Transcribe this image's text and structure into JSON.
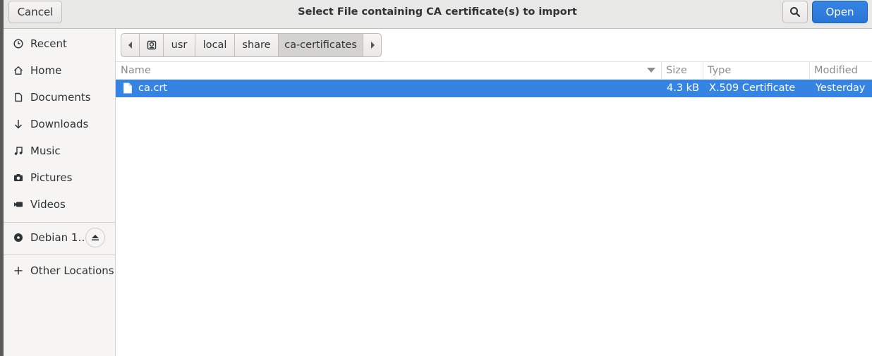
{
  "header": {
    "cancel_label": "Cancel",
    "title": "Select File containing CA certificate(s) to import",
    "open_label": "Open",
    "search_icon": "search-icon"
  },
  "sidebar": {
    "items": [
      {
        "label": "Recent",
        "icon": "clock-icon"
      },
      {
        "label": "Home",
        "icon": "home-icon"
      },
      {
        "label": "Documents",
        "icon": "document-icon"
      },
      {
        "label": "Downloads",
        "icon": "download-arrow-icon"
      },
      {
        "label": "Music",
        "icon": "music-note-icon"
      },
      {
        "label": "Pictures",
        "icon": "camera-icon"
      },
      {
        "label": "Videos",
        "icon": "video-camera-icon"
      }
    ],
    "device": {
      "label": "Debian 1…",
      "icon": "disc-icon",
      "eject_icon": "eject-icon"
    },
    "other_locations": {
      "label": "Other Locations",
      "icon": "plus-icon"
    }
  },
  "pathbar": {
    "crumbs": [
      "usr",
      "local",
      "share",
      "ca-certificates"
    ],
    "active": "ca-certificates"
  },
  "columns": {
    "name": "Name",
    "size": "Size",
    "type": "Type",
    "modified": "Modified"
  },
  "files": [
    {
      "name": "ca.crt",
      "size": "4.3 kB",
      "type": "X.509 Certificate",
      "modified": "Yesterday",
      "selected": true
    }
  ]
}
